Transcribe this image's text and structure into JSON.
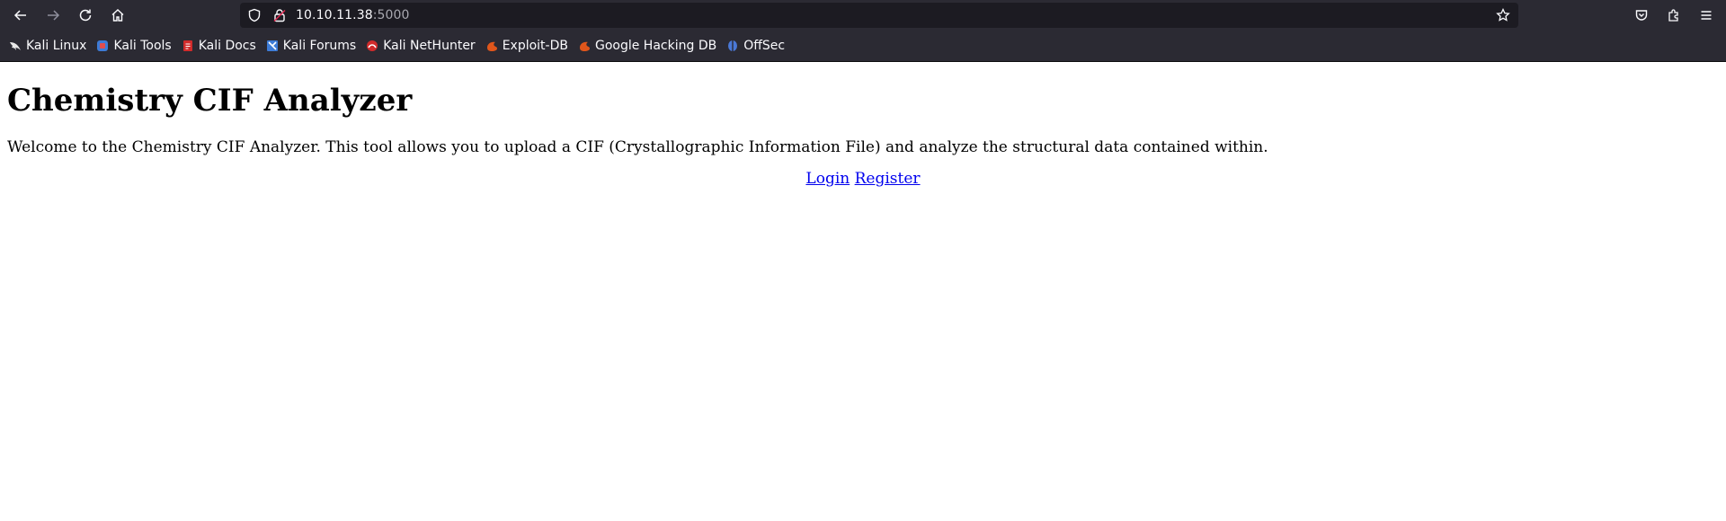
{
  "browser": {
    "url_host": "10.10.11.38",
    "url_port": ":5000",
    "bookmarks": [
      {
        "label": "Kali Linux",
        "icon": "kali-dragon-icon",
        "color": "#e8e8e8"
      },
      {
        "label": "Kali Tools",
        "icon": "kali-tools-icon",
        "color": "#3d7bd6"
      },
      {
        "label": "Kali Docs",
        "icon": "kali-docs-icon",
        "color": "#d12b2b"
      },
      {
        "label": "Kali Forums",
        "icon": "kali-forums-icon",
        "color": "#3d7bd6"
      },
      {
        "label": "Kali NetHunter",
        "icon": "kali-nethunter-icon",
        "color": "#d12b2b"
      },
      {
        "label": "Exploit-DB",
        "icon": "exploit-db-icon",
        "color": "#e0561b"
      },
      {
        "label": "Google Hacking DB",
        "icon": "ghdb-icon",
        "color": "#e0561b"
      },
      {
        "label": "OffSec",
        "icon": "offsec-icon",
        "color": "#4a78d6"
      }
    ]
  },
  "page": {
    "title": "Chemistry CIF Analyzer",
    "intro": "Welcome to the Chemistry CIF Analyzer. This tool allows you to upload a CIF (Crystallographic Information File) and analyze the structural data contained within.",
    "login_label": "Login",
    "register_label": "Register"
  }
}
